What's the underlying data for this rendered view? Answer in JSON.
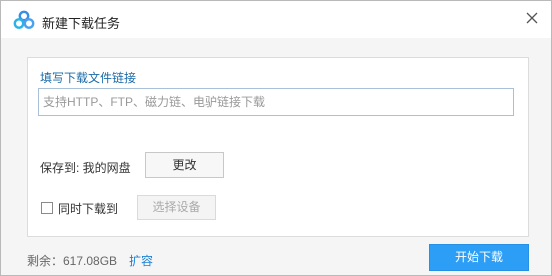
{
  "window": {
    "title": "新建下载任务",
    "logo_icon": "baidu-netdisk-cloud-icon",
    "close_icon": "close-icon"
  },
  "form": {
    "link_label": "填写下载文件链接",
    "url_input_value": "",
    "url_input_placeholder": "支持HTTP、FTP、磁力链、电驴链接下载",
    "save_to_label": "保存到: 我的网盘",
    "change_button": "更改",
    "sync_checkbox_checked": false,
    "sync_checkbox_label": "同时下载到",
    "select_device_button": "选择设备",
    "select_device_disabled": true
  },
  "footer": {
    "remaining": "剩余：617.08GB",
    "expand_link": "扩容",
    "start_button": "开始下载"
  },
  "colors": {
    "accent": "#2d9ef5",
    "link": "#1a82d8",
    "label_blue": "#1a6aa8",
    "background": "#f5f5f5"
  }
}
